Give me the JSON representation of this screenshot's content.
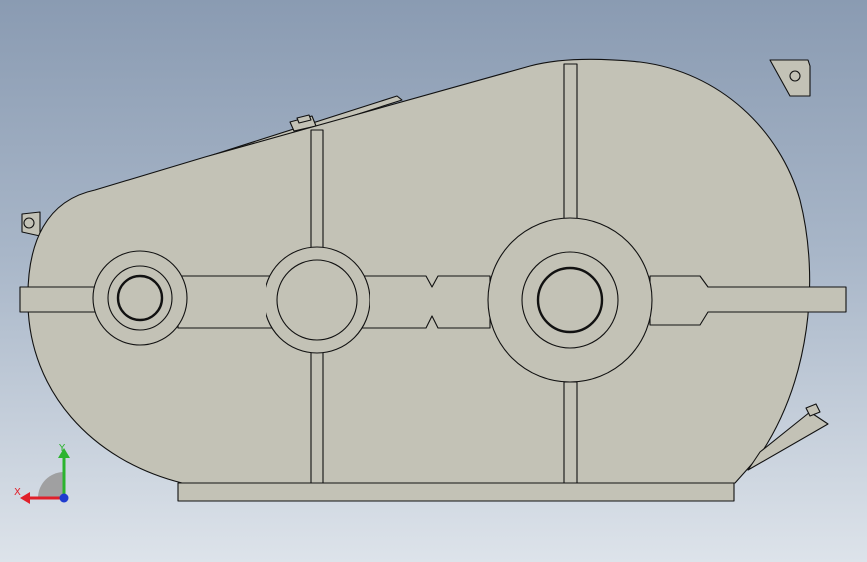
{
  "triad": {
    "x_label": "X",
    "y_label": "Y",
    "x_color": "#e0202a",
    "y_color": "#2bb42e",
    "z_color": "#1f3ccf"
  },
  "colors": {
    "background_top": "#8a9bb2",
    "background_bottom": "#dde3ea",
    "part_fill": "#c3c2b6",
    "part_edge": "#111111"
  },
  "icons": {
    "triad": "coordinate-triad-icon"
  }
}
